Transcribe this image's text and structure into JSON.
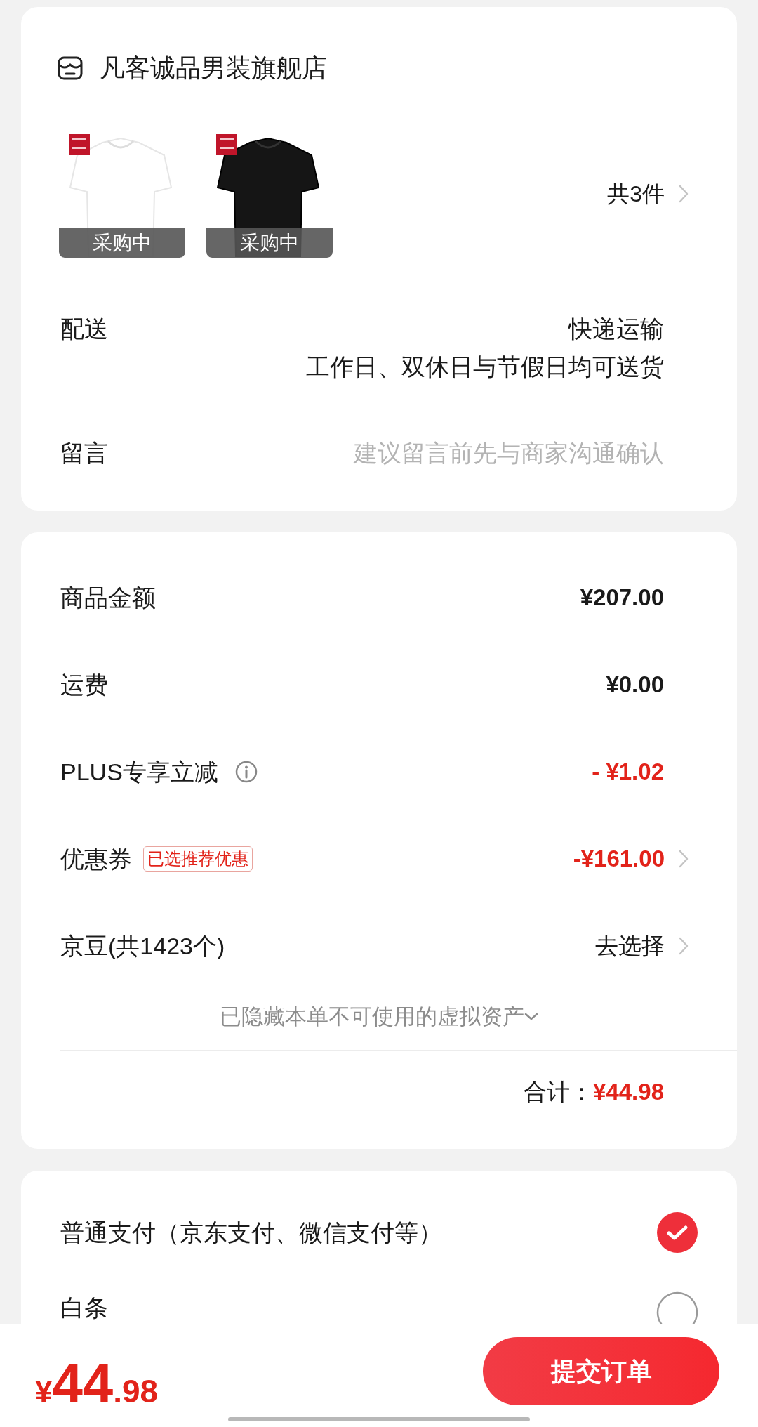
{
  "store": {
    "name": "凡客诚品男装旗舰店"
  },
  "products": [
    {
      "kind": "picture",
      "status": "采购中"
    },
    {
      "kind": "picture",
      "status": "采购中"
    }
  ],
  "item_count": "共3件",
  "delivery": {
    "label": "配送",
    "method": "快递运输",
    "note": "工作日、双休日与节假日均可送货"
  },
  "message": {
    "label": "留言",
    "placeholder": "建议留言前先与商家沟通确认"
  },
  "price_rows": [
    {
      "label": "商品金额",
      "value": "¥207.00",
      "discount": false,
      "info": false,
      "chevron": false
    },
    {
      "label": "运费",
      "value": "¥0.00",
      "discount": false,
      "info": false,
      "chevron": false
    },
    {
      "label": "PLUS专享立减",
      "value": "- ¥1.02",
      "discount": true,
      "info": true,
      "chevron": false
    },
    {
      "label": "优惠券",
      "badge": "已选推荐优惠",
      "value": "-¥161.00",
      "discount": true,
      "info": false,
      "chevron": true
    },
    {
      "label": "京豆(共1423个)",
      "value": "去选择",
      "discount": false,
      "info": false,
      "chevron": true
    }
  ],
  "hidden_assets": "已隐藏本单不可使用的虚拟资产",
  "total": {
    "label": "合计：",
    "value": "¥44.98"
  },
  "payment_methods": [
    {
      "label": "普通支付（京东支付、微信支付等）",
      "selected": true
    },
    {
      "label": "白条",
      "selected": false
    }
  ],
  "footer": {
    "currency": "¥",
    "amount_integer": "44",
    "amount_decimal": ".98",
    "submit": "提交订单"
  }
}
